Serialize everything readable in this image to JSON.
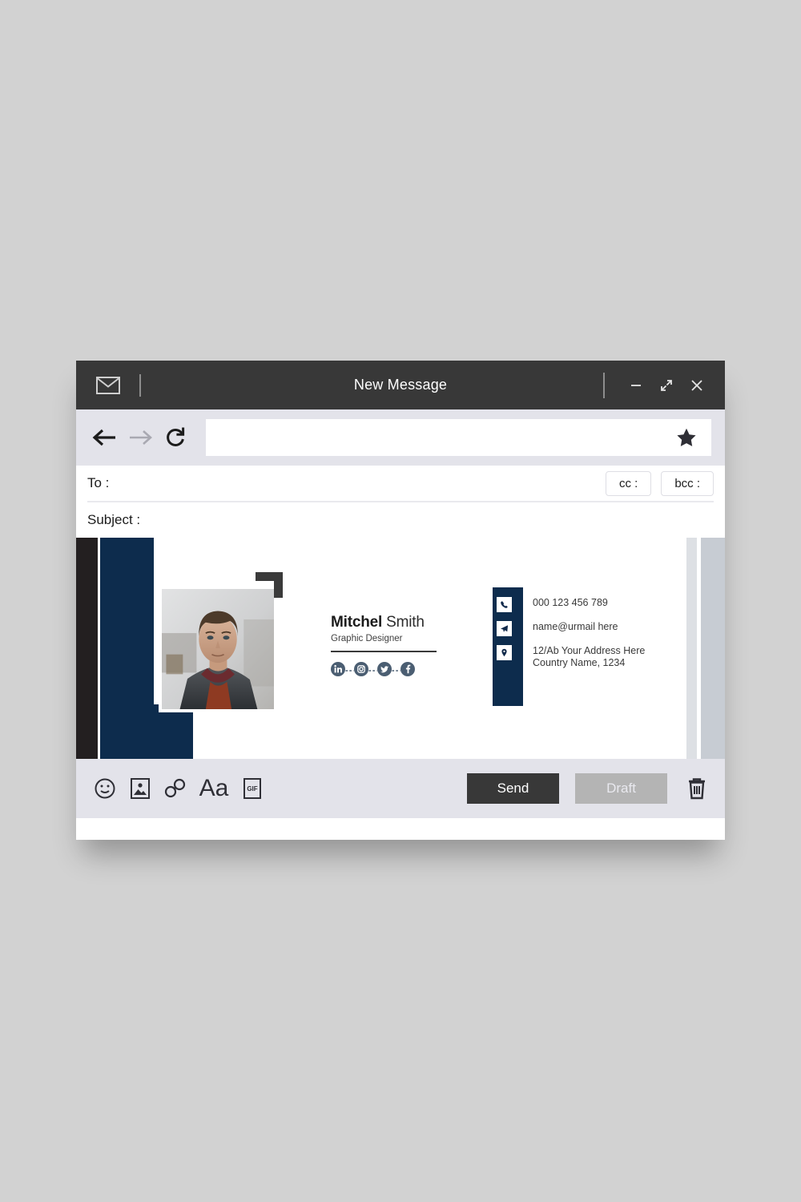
{
  "window": {
    "title": "New Message",
    "mail_icon": "envelope-icon",
    "controls": {
      "minimize": "minimize-icon",
      "maximize": "maximize-icon",
      "close": "close-icon"
    }
  },
  "navbar": {
    "back_icon": "arrow-left-icon",
    "forward_icon": "arrow-right-icon",
    "reload_icon": "reload-icon",
    "search_value": "",
    "search_placeholder": "",
    "star_icon": "star-icon"
  },
  "fields": {
    "to_label": "To :",
    "to_value": "",
    "to_placeholder": "",
    "cc_label": "cc :",
    "bcc_label": "bcc :",
    "subject_label": "Subject :",
    "subject_value": "",
    "subject_placeholder": ""
  },
  "signature": {
    "first_name": "Mitchel",
    "last_name": "Smith",
    "role": "Graphic Designer",
    "social": [
      {
        "name": "linkedin-icon",
        "label": "in"
      },
      {
        "name": "instagram-icon",
        "label": ""
      },
      {
        "name": "twitter-icon",
        "label": ""
      },
      {
        "name": "facebook-icon",
        "label": "f"
      }
    ],
    "contacts": [
      {
        "icon": "phone-icon",
        "line1": "000 123 456 789",
        "line2": ""
      },
      {
        "icon": "send-plane-icon",
        "line1": "name@urmail here",
        "line2": ""
      },
      {
        "icon": "location-pin-icon",
        "line1": "12/Ab Your Address Here",
        "line2": "Country Name, 1234"
      }
    ],
    "photo_alt": "portrait-photo"
  },
  "toolbar": {
    "icons": [
      {
        "name": "emoji-icon"
      },
      {
        "name": "image-icon"
      },
      {
        "name": "link-icon"
      },
      {
        "name": "text-format-icon",
        "label": "Aa"
      },
      {
        "name": "gif-icon",
        "label": "GIF"
      }
    ],
    "send_label": "Send",
    "draft_label": "Draft",
    "trash_icon": "trash-icon"
  },
  "colors": {
    "titlebar": "#383838",
    "navbar": "#e3e3ea",
    "navy": "#0d2c4d",
    "black_bar": "#231f20",
    "send_bg": "#383838",
    "draft_bg": "#b4b4b4",
    "page_bg": "#d2d2d2"
  }
}
